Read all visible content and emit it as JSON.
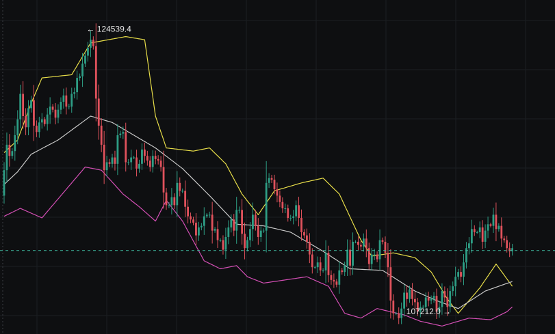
{
  "chart_data": {
    "type": "candlestick",
    "title": "",
    "xlabel": "",
    "ylabel": "",
    "ylim": [
      105800,
      126800
    ],
    "grid": true,
    "colors": {
      "background": "#0e0f11",
      "grid": "#1c1f23",
      "up": "#2e9e85",
      "down": "#e0525c",
      "upper_band": "#e7dd49",
      "middle_band": "#c8c8c8",
      "lower_band": "#d44fb5",
      "current_price_line": "#3fb8a0",
      "annotation_text": "#e8e8e8"
    },
    "current_price": 111050,
    "annotations": {
      "high": {
        "text": "← 124539.4",
        "value": 124539.4,
        "index": 32
      },
      "low": {
        "text": "107212.0 →",
        "value": 107212.0,
        "index": 164
      }
    },
    "bollinger": {
      "upper": [
        [
          0,
          117200
        ],
        [
          5,
          118000
        ],
        [
          10,
          120300
        ],
        [
          14,
          121900
        ],
        [
          25,
          122100
        ],
        [
          32,
          124100
        ],
        [
          45,
          124500
        ],
        [
          52,
          124300
        ],
        [
          56,
          119500
        ],
        [
          60,
          117500
        ],
        [
          70,
          117300
        ],
        [
          76,
          117500
        ],
        [
          82,
          116500
        ],
        [
          88,
          114600
        ],
        [
          94,
          113300
        ],
        [
          100,
          114800
        ],
        [
          110,
          115300
        ],
        [
          118,
          115600
        ],
        [
          124,
          114600
        ],
        [
          132,
          111700
        ],
        [
          136,
          110700
        ],
        [
          144,
          110900
        ],
        [
          152,
          110600
        ],
        [
          158,
          109700
        ],
        [
          164,
          108000
        ],
        [
          168,
          107100
        ],
        [
          176,
          108700
        ],
        [
          182,
          110200
        ],
        [
          188,
          108800
        ]
      ],
      "middle": [
        [
          0,
          115200
        ],
        [
          5,
          116000
        ],
        [
          10,
          117100
        ],
        [
          20,
          118000
        ],
        [
          32,
          119500
        ],
        [
          40,
          119100
        ],
        [
          48,
          118300
        ],
        [
          56,
          117500
        ],
        [
          66,
          116200
        ],
        [
          76,
          114500
        ],
        [
          86,
          112700
        ],
        [
          96,
          112600
        ],
        [
          106,
          112200
        ],
        [
          118,
          111000
        ],
        [
          128,
          109900
        ],
        [
          140,
          109800
        ],
        [
          152,
          108500
        ],
        [
          160,
          107900
        ],
        [
          168,
          107400
        ],
        [
          178,
          108500
        ],
        [
          188,
          109100
        ]
      ],
      "lower": [
        [
          0,
          113200
        ],
        [
          6,
          113700
        ],
        [
          14,
          113100
        ],
        [
          22,
          114700
        ],
        [
          30,
          116300
        ],
        [
          36,
          116100
        ],
        [
          44,
          114600
        ],
        [
          50,
          113800
        ],
        [
          56,
          112900
        ],
        [
          60,
          114200
        ],
        [
          66,
          112900
        ],
        [
          74,
          110400
        ],
        [
          80,
          109900
        ],
        [
          86,
          110100
        ],
        [
          90,
          109400
        ],
        [
          96,
          109000
        ],
        [
          104,
          109200
        ],
        [
          112,
          109400
        ],
        [
          120,
          108800
        ],
        [
          126,
          107100
        ],
        [
          132,
          106800
        ],
        [
          138,
          107400
        ],
        [
          148,
          107000
        ],
        [
          154,
          106600
        ],
        [
          162,
          106300
        ],
        [
          172,
          106800
        ],
        [
          180,
          106700
        ],
        [
          186,
          107200
        ],
        [
          188,
          107500
        ]
      ]
    },
    "candles": {
      "start_index": 0,
      "close": [
        116100,
        117700,
        117000,
        117300,
        118300,
        119300,
        120900,
        119500,
        118800,
        120000,
        120500,
        118900,
        118500,
        119100,
        119300,
        119000,
        119600,
        120100,
        119900,
        119400,
        119900,
        120400,
        120800,
        120100,
        120100,
        120900,
        121000,
        121900,
        122000,
        122800,
        123300,
        123800,
        124300,
        123900,
        120600,
        118900,
        117700,
        116100,
        116600,
        116500,
        116900,
        116500,
        118300,
        118400,
        118500,
        116600,
        116600,
        116900,
        116900,
        116200,
        116500,
        117400,
        117000,
        116700,
        116300,
        117000,
        116800,
        116700,
        116300,
        114700,
        113900,
        113900,
        114400,
        113900,
        115300,
        114800,
        114800,
        113800,
        113200,
        113000,
        112800,
        112000,
        112500,
        112600,
        113200,
        113300,
        113300,
        112300,
        112400,
        111700,
        111700,
        111100,
        111900,
        112500,
        113000,
        112300,
        113600,
        113600,
        112100,
        111200,
        111700,
        112400,
        113300,
        112600,
        111900,
        112300,
        112300,
        115300,
        115600,
        115500,
        114900,
        114500,
        114100,
        113700,
        113700,
        113100,
        113100,
        113200,
        113900,
        113100,
        112200,
        112000,
        111600,
        110800,
        110000,
        110000,
        110300,
        109800,
        109800,
        110900,
        109500,
        109200,
        109100,
        108900,
        109800,
        109700,
        110100,
        111100,
        110100,
        111600,
        111600,
        111400,
        111300,
        111800,
        111200,
        110200,
        110800,
        110800,
        110500,
        111700,
        111600,
        110900,
        110000,
        107900,
        107100,
        107100,
        106800,
        107400,
        108400,
        108000,
        108600,
        108000,
        107800,
        107200,
        107500,
        107500,
        108100,
        107900,
        108000,
        108200,
        107200,
        107500,
        108500,
        108100,
        107500,
        108500,
        108800,
        109400,
        109700,
        109400,
        110300,
        111200,
        111500,
        112400,
        112200,
        112200,
        112500,
        111600,
        112300,
        112700,
        112600,
        113300,
        112400,
        112600,
        111800,
        111700,
        111200,
        111000,
        111200
      ],
      "opens_are_previous_close": true,
      "open0": 114500
    }
  }
}
